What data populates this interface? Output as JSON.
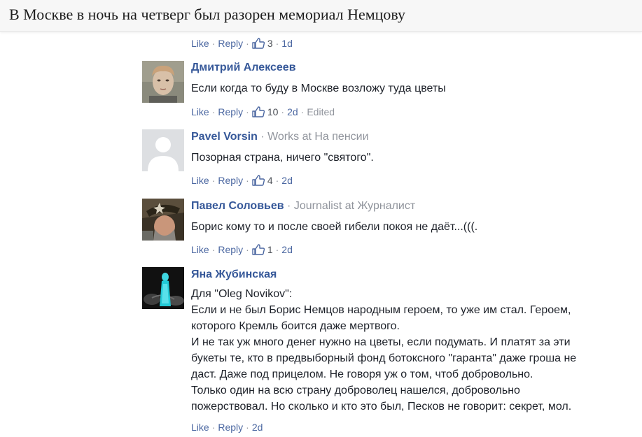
{
  "page_title": "В Москве в ночь на четверг был разорен мемориал Немцову",
  "top_actions": {
    "like": "Like",
    "reply": "Reply",
    "likes": "3",
    "time": "1d"
  },
  "comments": [
    {
      "author": "Дмитрий Алексеев",
      "workline": "",
      "text": "Если когда то буду в Москве возложу туда цветы",
      "like": "Like",
      "reply": "Reply",
      "likes": "10",
      "time": "2d",
      "edited": "Edited"
    },
    {
      "author": "Pavel Vorsin",
      "workline": "Works at На пенсии",
      "text": "Позорная страна, ничего \"святого\".",
      "like": "Like",
      "reply": "Reply",
      "likes": "4",
      "time": "2d"
    },
    {
      "author": "Павел Соловьев",
      "workline": "Journalist at Журналист",
      "text": "Борис кому то и после своей гибели покоя не даёт...(((.",
      "like": "Like",
      "reply": "Reply",
      "likes": "1",
      "time": "2d"
    },
    {
      "author": "Яна Жубинская",
      "workline": "",
      "text": "Для \"Oleg Novikov\":\nЕсли и не был Борис Немцов народным героем, то уже им стал. Героем,\nкоторого Кремль боится даже мертвого.\nИ не так уж много денег нужно на цветы, если подумать. И платят за эти\nбукеты те, кто в предвыборный фонд ботоксного \"гаранта\" даже гроша не\nдаст. Даже под прицелом. Не говоря уж о том, чтоб добровольно.\nТолько один на всю страну доброволец нашелся, добровольно\nпожерствовал. Но сколько и кто это был, Песков не говорит: секрет, мол.",
      "like": "Like",
      "reply": "Reply",
      "time": "2d"
    }
  ],
  "separator": "·",
  "colors": {
    "link": "#4b67a1",
    "author": "#365899",
    "meta": "#90949c",
    "text": "#1d2129"
  }
}
